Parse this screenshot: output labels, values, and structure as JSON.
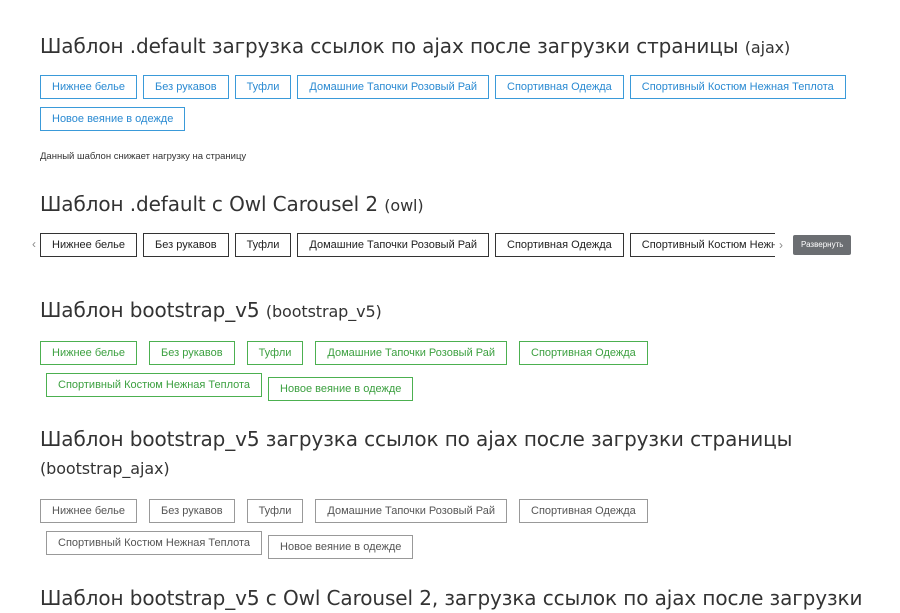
{
  "sections": [
    {
      "title": "Шаблон .default загрузка ссылок по ajax после загрузки страницы",
      "subtitle": "(ajax)",
      "tags": [
        "Нижнее белье",
        "Без рукавов",
        "Туфли",
        "Домашние Тапочки Розовый Рай",
        "Спортивная Одежда",
        "Спортивный Костюм Нежная Теплота",
        "Новое веяние в одежде"
      ],
      "note": "Данный шаблон снижает нагрузку на страницу"
    },
    {
      "title": "Шаблон .default с Owl Carousel 2",
      "subtitle": "(owl)",
      "tags": [
        "Нижнее белье",
        "Без рукавов",
        "Туфли",
        "Домашние Тапочки Розовый Рай",
        "Спортивная Одежда",
        "Спортивный Костюм Нежная Теплота"
      ],
      "prev_arrow": "‹",
      "next_arrow": "›",
      "expand_label": "Развернуть"
    },
    {
      "title": "Шаблон bootstrap_v5",
      "subtitle": "(bootstrap_v5)",
      "tags": [
        "Нижнее белье",
        "Без рукавов",
        "Туфли",
        "Домашние Тапочки Розовый Рай",
        "Спортивная Одежда",
        "Спортивный Костюм Нежная Теплота",
        "Новое веяние в одежде"
      ]
    },
    {
      "title": "Шаблон bootstrap_v5 загрузка ссылок по ajax после загрузки страницы",
      "subtitle": "(bootstrap_ajax)",
      "tags": [
        "Нижнее белье",
        "Без рукавов",
        "Туфли",
        "Домашние Тапочки Розовый Рай",
        "Спортивная Одежда",
        "Спортивный Костюм Нежная Теплота",
        "Новое веяние в одежде"
      ]
    },
    {
      "title": "Шаблон bootstrap_v5 с Owl Carousel 2, загрузка ссылок по ajax после загрузки"
    }
  ],
  "colors": {
    "ajax_border": "#3a9ad9",
    "owl_border": "#333333",
    "bootstrap_border": "#4cb050",
    "bootstrap_ajax_border": "#999999",
    "expand_button": "#6b6e72"
  }
}
